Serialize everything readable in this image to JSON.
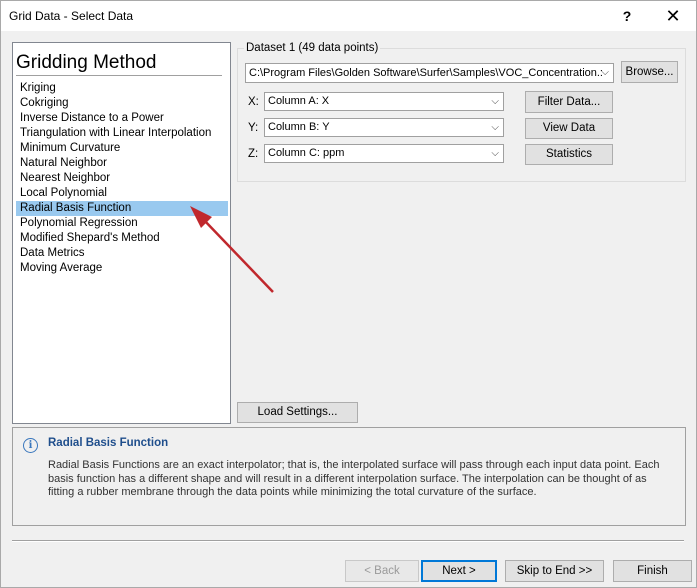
{
  "window": {
    "title": "Grid Data - Select Data",
    "help": "?",
    "close": "✕"
  },
  "method": {
    "heading": "Gridding Method",
    "items": [
      "Kriging",
      "Cokriging",
      "Inverse Distance to a Power",
      "Triangulation with Linear Interpolation",
      "Minimum Curvature",
      "Natural Neighbor",
      "Nearest Neighbor",
      "Local Polynomial",
      "Radial Basis Function",
      "Polynomial Regression",
      "Modified Shepard's Method",
      "Data Metrics",
      "Moving Average"
    ],
    "selected_index": 8
  },
  "dataset": {
    "label": "Dataset 1  (49 data points)",
    "path": "C:\\Program Files\\Golden Software\\Surfer\\Samples\\VOC_Concentration.:",
    "browse": "Browse...",
    "x_label": "X:",
    "x_value": "Column A:  X",
    "y_label": "Y:",
    "y_value": "Column B:  Y",
    "z_label": "Z:",
    "z_value": "Column C:  ppm",
    "filter": "Filter Data...",
    "view": "View Data",
    "statistics": "Statistics",
    "load_settings": "Load Settings..."
  },
  "info": {
    "icon": "i",
    "title": "Radial Basis Function",
    "text": "Radial Basis Functions are an exact interpolator; that is, the interpolated surface will pass through each input data point.  Each basis function has a different shape and will result in a different interpolation surface.  The interpolation can be thought of as fitting a rubber membrane through the data points while minimizing the total curvature of the surface."
  },
  "footer": {
    "back": "< Back",
    "next": "Next >",
    "skip": "Skip to End >>",
    "finish": "Finish"
  },
  "colors": {
    "selection": "#99c9ef",
    "annotation_arrow": "#c0282d",
    "info_title": "#1f4e8c"
  },
  "icons": {
    "dropdown": "chevron-down-icon",
    "info": "info-icon",
    "arrow": "annotation-arrow"
  }
}
